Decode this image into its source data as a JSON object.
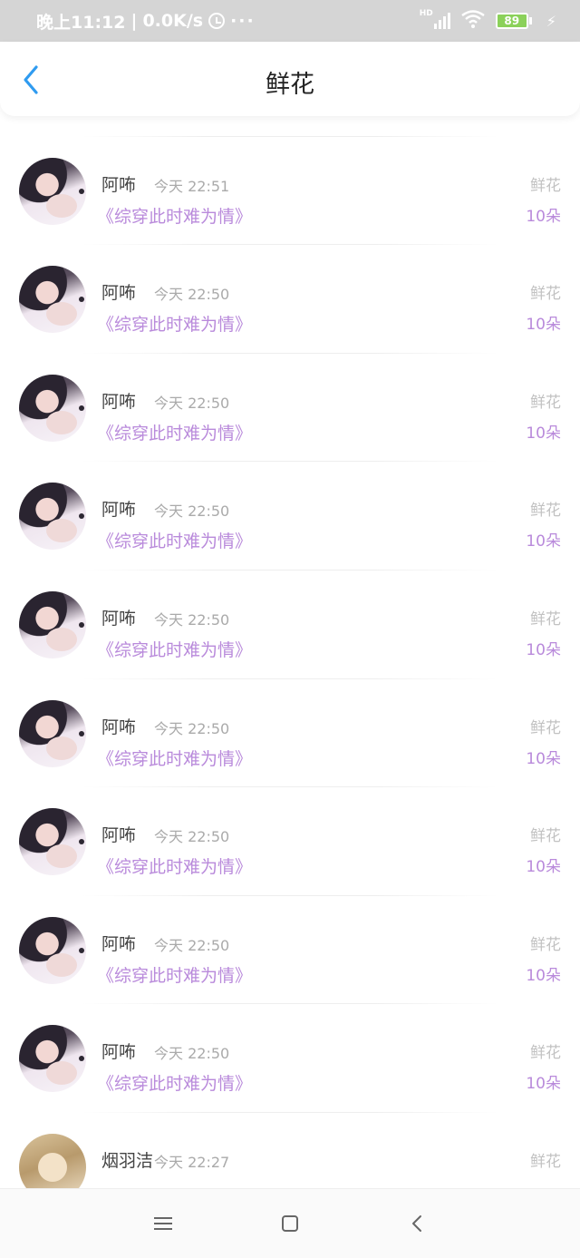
{
  "status_bar": {
    "time": "晚上11:12",
    "separator": "|",
    "network_speed": "0.0K/s",
    "more_dots": "···",
    "hd_label": "HD",
    "battery_level": "89",
    "icons": [
      "alarm-icon",
      "hd-signal-icon",
      "wifi-icon",
      "battery-icon",
      "charging-icon"
    ]
  },
  "header": {
    "title": "鲜花",
    "back_icon": "chevron-left-icon",
    "accent_color": "#2f9bf0"
  },
  "colors": {
    "book_title": "#b98adb",
    "count": "#b98adb",
    "time": "#aaaaaa",
    "gift_label": "#c2c2c2"
  },
  "records": [
    {
      "name": "",
      "time": "",
      "book": "《综穿此时难为情》",
      "gift": "",
      "count": "10朵"
    },
    {
      "name": "阿咘",
      "time": "今天 22:51",
      "book": "《综穿此时难为情》",
      "gift": "鲜花",
      "count": "10朵"
    },
    {
      "name": "阿咘",
      "time": "今天 22:50",
      "book": "《综穿此时难为情》",
      "gift": "鲜花",
      "count": "10朵"
    },
    {
      "name": "阿咘",
      "time": "今天 22:50",
      "book": "《综穿此时难为情》",
      "gift": "鲜花",
      "count": "10朵"
    },
    {
      "name": "阿咘",
      "time": "今天 22:50",
      "book": "《综穿此时难为情》",
      "gift": "鲜花",
      "count": "10朵"
    },
    {
      "name": "阿咘",
      "time": "今天 22:50",
      "book": "《综穿此时难为情》",
      "gift": "鲜花",
      "count": "10朵"
    },
    {
      "name": "阿咘",
      "time": "今天 22:50",
      "book": "《综穿此时难为情》",
      "gift": "鲜花",
      "count": "10朵"
    },
    {
      "name": "阿咘",
      "time": "今天 22:50",
      "book": "《综穿此时难为情》",
      "gift": "鲜花",
      "count": "10朵"
    },
    {
      "name": "阿咘",
      "time": "今天 22:50",
      "book": "《综穿此时难为情》",
      "gift": "鲜花",
      "count": "10朵"
    },
    {
      "name": "阿咘",
      "time": "今天 22:50",
      "book": "《综穿此时难为情》",
      "gift": "鲜花",
      "count": "10朵"
    },
    {
      "name": "烟羽洁",
      "time": "今天 22:27",
      "book": "",
      "gift": "鲜花",
      "count": ""
    }
  ],
  "navbar": {
    "icons": [
      "menu-icon",
      "home-icon",
      "back-icon"
    ]
  }
}
